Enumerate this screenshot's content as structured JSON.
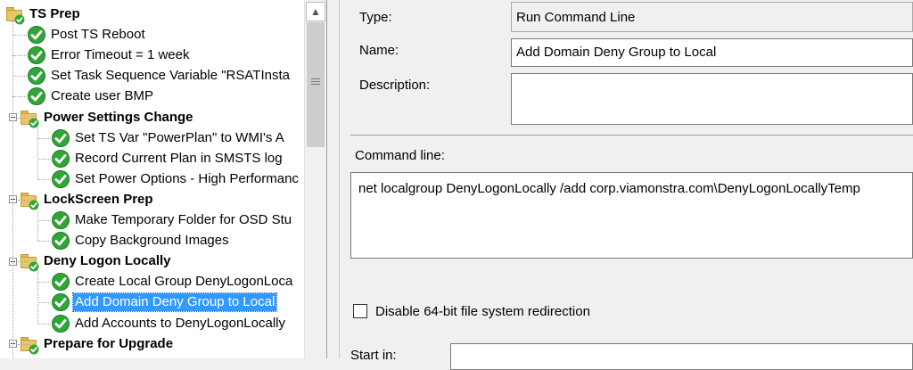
{
  "tree": {
    "items": [
      {
        "label": "TS Prep",
        "type": "group"
      },
      {
        "label": "Post TS Reboot",
        "type": "step"
      },
      {
        "label": "Error Timeout = 1 week",
        "type": "step"
      },
      {
        "label": "Set Task Sequence Variable \"RSATInsta",
        "type": "step"
      },
      {
        "label": "Create user BMP",
        "type": "step"
      },
      {
        "label": "Power Settings Change",
        "type": "group"
      },
      {
        "label": "Set TS Var \"PowerPlan\" to WMI's A",
        "type": "step"
      },
      {
        "label": "Record Current Plan in SMSTS log",
        "type": "step"
      },
      {
        "label": "Set Power Options - High Performanc",
        "type": "step"
      },
      {
        "label": "LockScreen Prep",
        "type": "group"
      },
      {
        "label": "Make Temporary Folder for OSD Stu",
        "type": "step"
      },
      {
        "label": "Copy Background Images",
        "type": "step"
      },
      {
        "label": "Deny Logon Locally",
        "type": "group"
      },
      {
        "label": "Create Local Group DenyLogonLoca",
        "type": "step"
      },
      {
        "label": "Add Domain Deny Group to Local",
        "type": "step",
        "selected": true
      },
      {
        "label": "Add Accounts to DenyLogonLocally",
        "type": "step"
      },
      {
        "label": "Prepare for Upgrade",
        "type": "group"
      }
    ]
  },
  "properties": {
    "type_label": "Type:",
    "type_value": "Run Command Line",
    "name_label": "Name:",
    "name_value": "Add Domain Deny Group to Local",
    "description_label": "Description:",
    "description_value": "",
    "command_line_label": "Command line:",
    "command_line_value": "net localgroup DenyLogonLocally /add corp.viamonstra.com\\DenyLogonLocallyTemp",
    "disable_redirection_label": "Disable 64-bit file system redirection",
    "start_in_label": "Start in:"
  },
  "colors": {
    "selection": "#3399ff",
    "check_green": "#2fa637",
    "folder": "#e9c567"
  }
}
